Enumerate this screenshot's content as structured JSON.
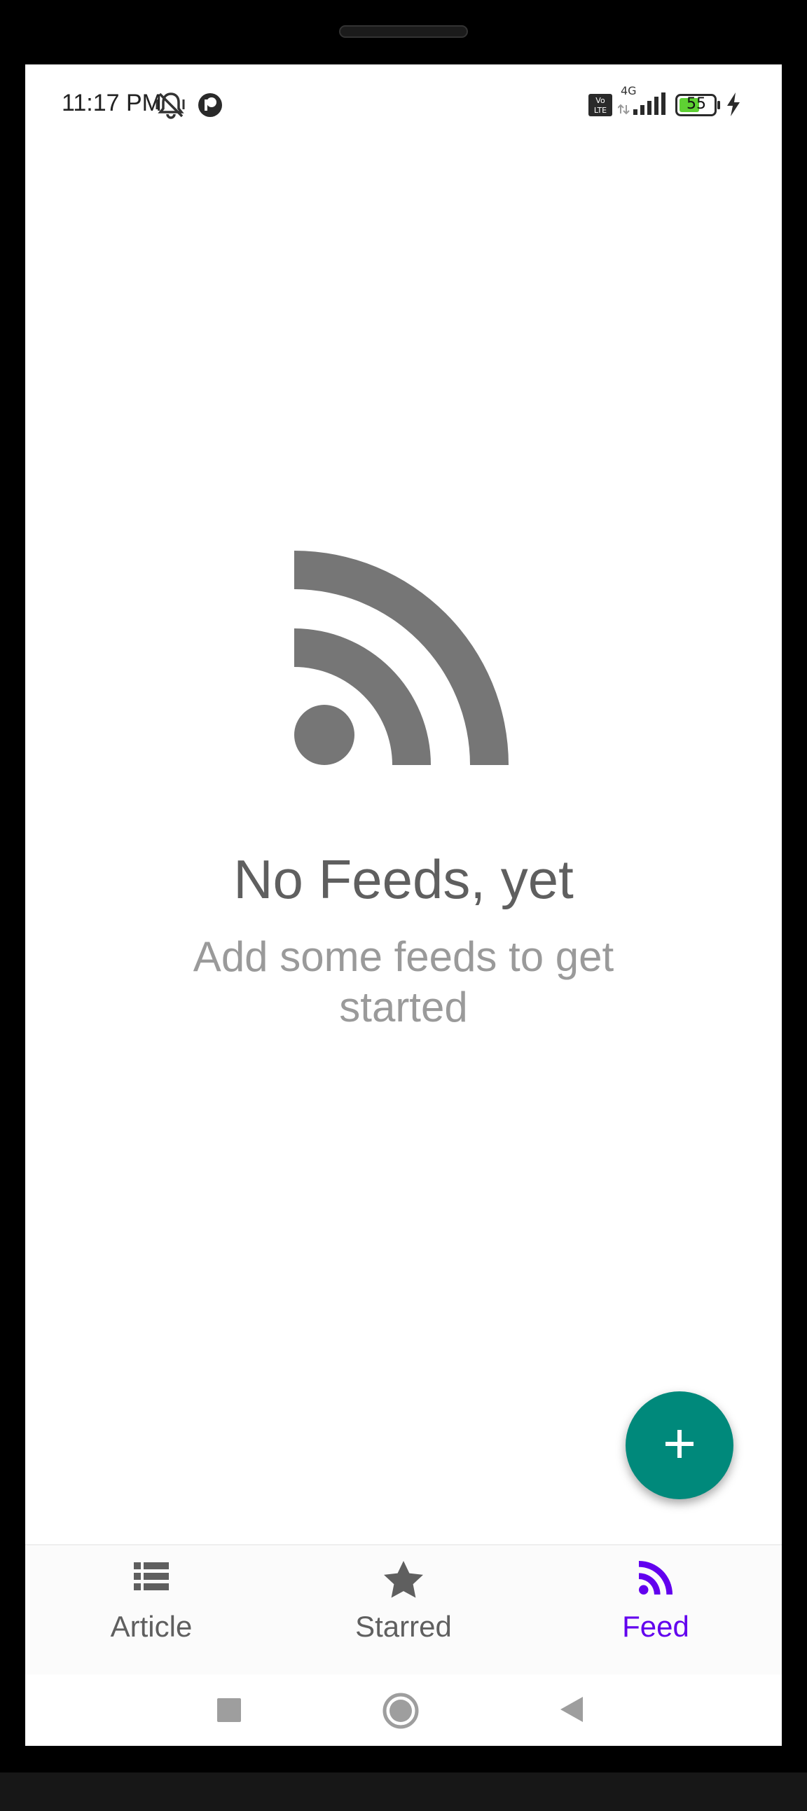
{
  "status_bar": {
    "time": "11:17 PM",
    "network": "4G",
    "battery_level": "55",
    "icons": [
      "bell-muted-icon",
      "app-notification-icon",
      "volte-icon",
      "signal-icon",
      "battery-icon",
      "charging-bolt-icon"
    ]
  },
  "empty_state": {
    "icon": "rss-feed-icon",
    "title": "No Feeds, yet",
    "subtitle": "Add some feeds to get started"
  },
  "fab": {
    "icon": "plus-icon",
    "color": "#00897b"
  },
  "bottom_nav": {
    "items": [
      {
        "label": "Article",
        "icon": "list-icon",
        "active": false
      },
      {
        "label": "Starred",
        "icon": "star-icon",
        "active": false
      },
      {
        "label": "Feed",
        "icon": "rss-icon",
        "active": true
      }
    ],
    "active_color": "#6200ee",
    "inactive_color": "#5f5f5f"
  },
  "system_nav": {
    "buttons": [
      "recents-button",
      "home-button",
      "back-button"
    ]
  }
}
